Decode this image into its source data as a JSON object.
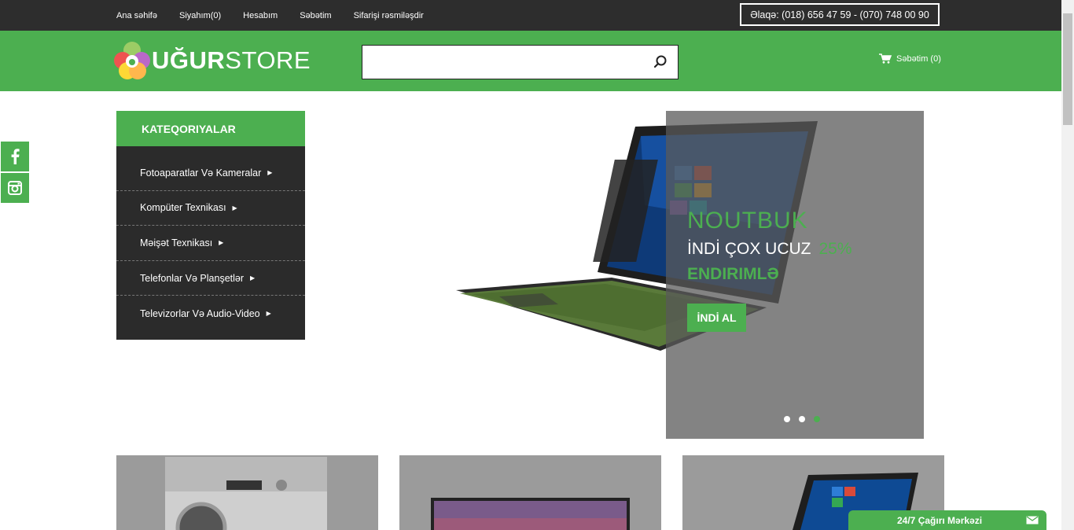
{
  "topnav": {
    "items": [
      "Ana səhifə",
      "Siyahım(0)",
      "Hesabım",
      "Səbətim",
      "Sifarişi rəsmiləşdir"
    ],
    "contact": "Əlaqə: (018) 656 47 59 - (070) 748 00 90"
  },
  "header": {
    "logo_bold": "UĞUR",
    "logo_light": "STORE",
    "search": {
      "value": "",
      "placeholder": ""
    },
    "cart_label": "Səbətim (0)"
  },
  "social": {
    "items": [
      "facebook-icon",
      "instagram-icon"
    ]
  },
  "categories": {
    "title": "KATEQORIYALAR",
    "items": [
      "Fotoaparatlar Və Kameralar",
      "Kompüter Texnikası",
      "Məişət Texnikası",
      "Telefonlar Və Planşetlər",
      "Televizorlar Və Audio-Video"
    ]
  },
  "slider": {
    "title": "NOUTBUK",
    "line": "İNDİ ÇOX UCUZ",
    "percent": "25%",
    "discount": "ENDIRIMLƏ",
    "button": "İNDİ AL",
    "slide_count": 3,
    "active_slide": 3
  },
  "call_center": {
    "label": "24/7 Çağırı Mərkəzi"
  },
  "colors": {
    "accent": "#4caf50",
    "dark": "#2d2d2d",
    "panel": "#2b2b2b"
  }
}
